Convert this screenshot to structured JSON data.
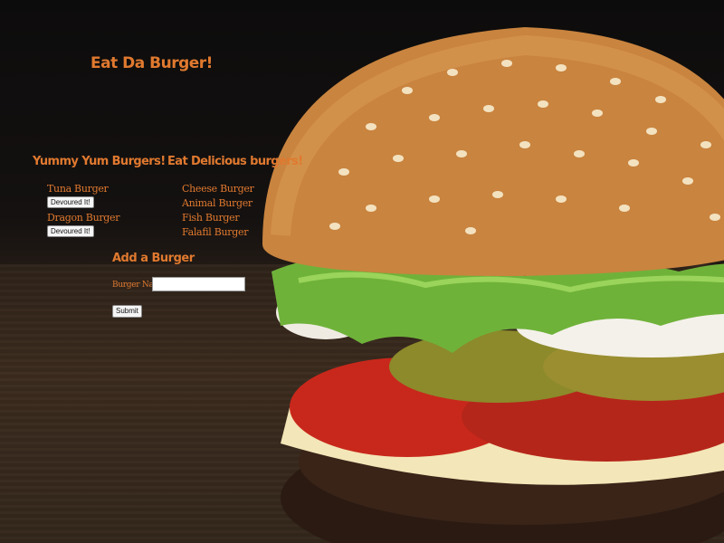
{
  "page": {
    "title": "Eat Da Burger!"
  },
  "colors": {
    "accent": "#e0792f",
    "background": "#1b1512"
  },
  "uneaten": {
    "heading": "Yummy Yum Burgers!",
    "items": [
      {
        "name": "Tuna Burger",
        "button": "Devoured It!"
      },
      {
        "name": "Dragon Burger",
        "button": "Devoured It!"
      }
    ]
  },
  "eaten": {
    "heading": "Eat Delicious burgers!",
    "items": [
      {
        "name": "Cheese Burger"
      },
      {
        "name": "Animal Burger"
      },
      {
        "name": "Fish Burger"
      },
      {
        "name": "Falafil Burger"
      }
    ]
  },
  "add_form": {
    "heading": "Add a Burger",
    "label": "Burger Name:",
    "input_value": "",
    "submit_label": "Submit"
  }
}
